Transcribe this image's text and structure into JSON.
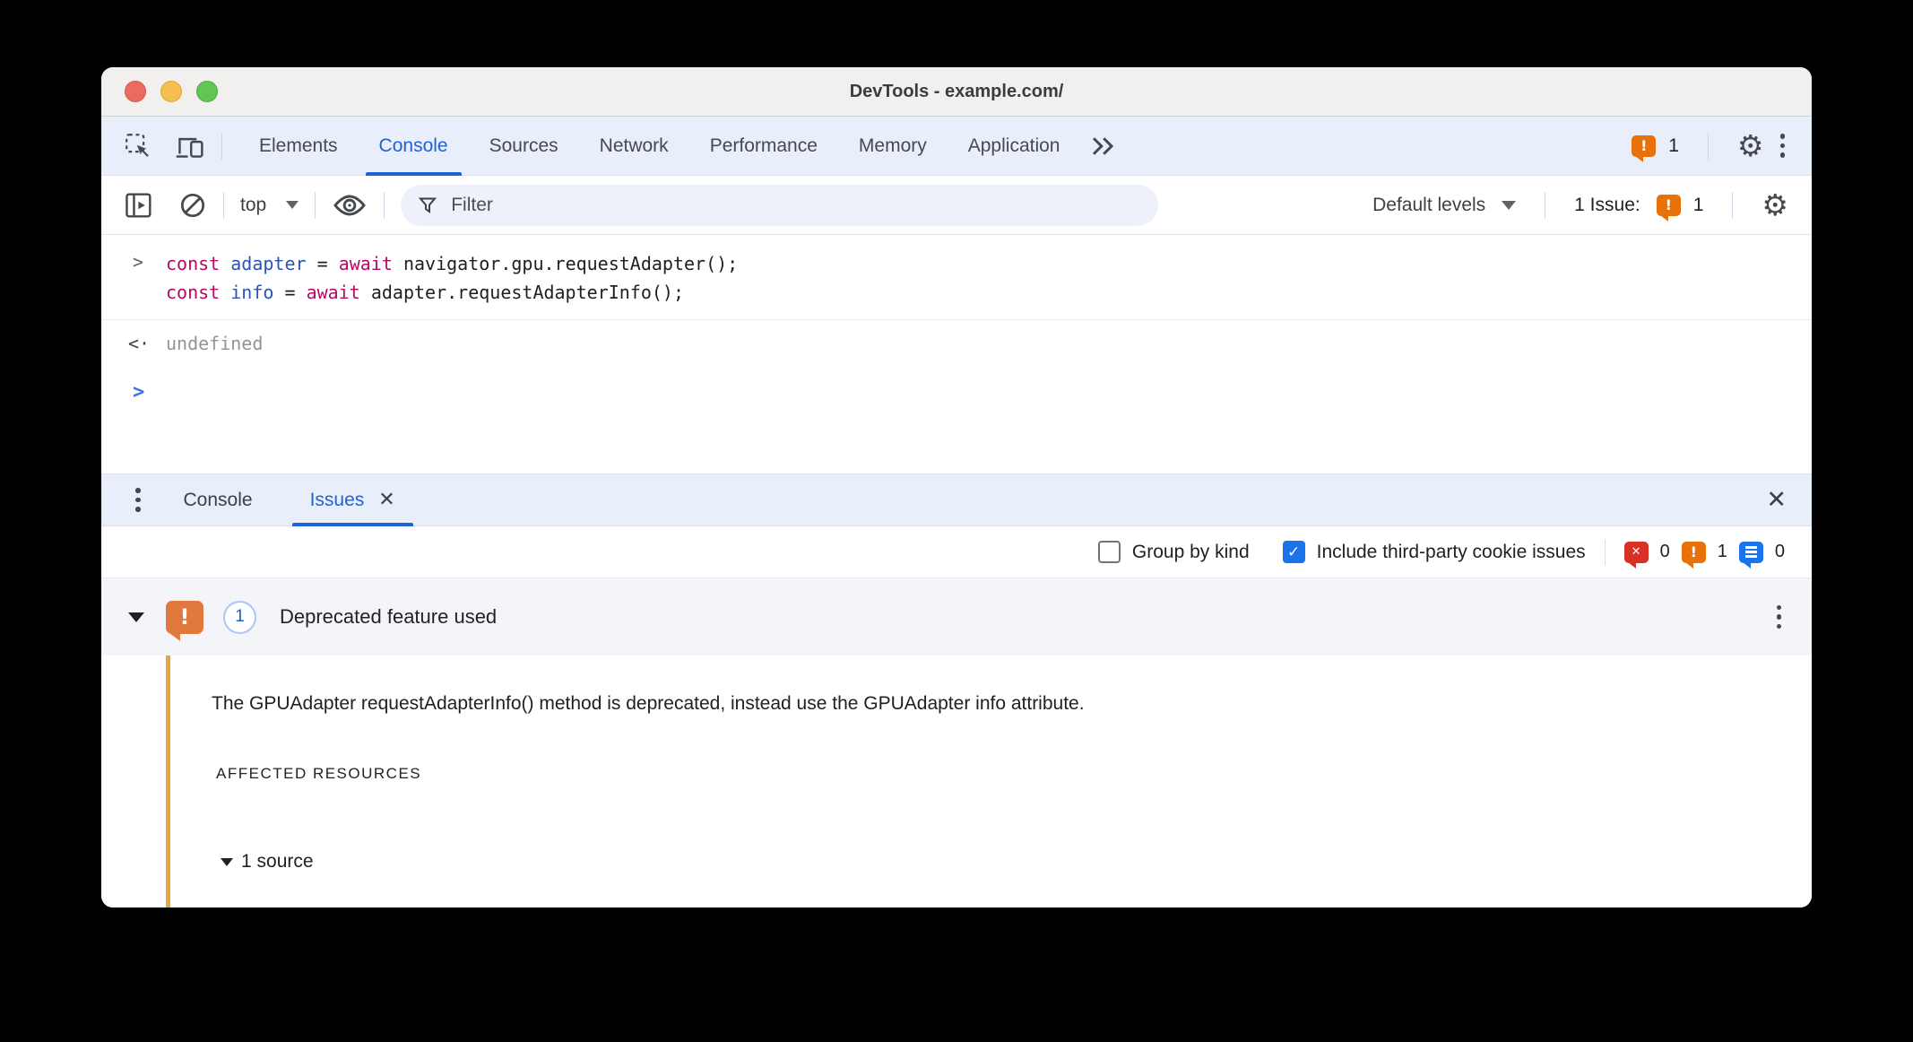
{
  "window": {
    "title": "DevTools - example.com/"
  },
  "main_tabs": {
    "items": [
      "Elements",
      "Console",
      "Sources",
      "Network",
      "Performance",
      "Memory",
      "Application"
    ],
    "selected": "Console",
    "issue_badge_count": "1"
  },
  "console_toolbar": {
    "context_selector": "top",
    "filter_placeholder": "Filter",
    "levels_selector": "Default levels",
    "issue_counter_label": "1 Issue:",
    "issue_counter_count": "1"
  },
  "console": {
    "prompt_char": ">",
    "return_glyph": "<·",
    "code_line1": [
      {
        "text": "const",
        "type": "keyword"
      },
      {
        "text": " ",
        "type": "plain"
      },
      {
        "text": "adapter",
        "type": "variable"
      },
      {
        "text": " = ",
        "type": "plain"
      },
      {
        "text": "await",
        "type": "keyword"
      },
      {
        "text": " navigator.gpu.requestAdapter();",
        "type": "plain"
      }
    ],
    "code_line2": [
      {
        "text": "const",
        "type": "keyword"
      },
      {
        "text": " ",
        "type": "plain"
      },
      {
        "text": "info",
        "type": "variable"
      },
      {
        "text": " = ",
        "type": "plain"
      },
      {
        "text": "await",
        "type": "keyword"
      },
      {
        "text": " adapter.requestAdapterInfo();",
        "type": "plain"
      }
    ],
    "result_value": "undefined"
  },
  "drawer": {
    "tabs": [
      "Console",
      "Issues"
    ],
    "selected": "Issues",
    "close_glyph": "✕"
  },
  "issues_toolbar": {
    "group_by_kind_label": "Group by kind",
    "group_by_kind_checked": false,
    "third_party_label": "Include third-party cookie issues",
    "third_party_checked": true,
    "check_glyph": "✓",
    "error_count": "0",
    "warning_count": "1",
    "info_count": "0"
  },
  "issue": {
    "count": "1",
    "title": "Deprecated feature used",
    "description": "The GPUAdapter requestAdapterInfo() method is deprecated, instead use the GPUAdapter info attribute.",
    "affected_resources_label": "AFFECTED RESOURCES",
    "sources_label": "1 source"
  },
  "glyphs": {
    "gear": "⚙",
    "warning_mark": "!",
    "error_mark": "✕"
  },
  "colors": {
    "accent_blue": "#1f62d8",
    "checkbox_blue": "#1a73e8",
    "warning_orange": "#e8710a",
    "error_red": "#d93025",
    "info_blue": "#1a73e8",
    "issue_rule_orange": "#e9a43e",
    "keyword_token": "#b40a64",
    "variable_token": "#2b55b5"
  }
}
